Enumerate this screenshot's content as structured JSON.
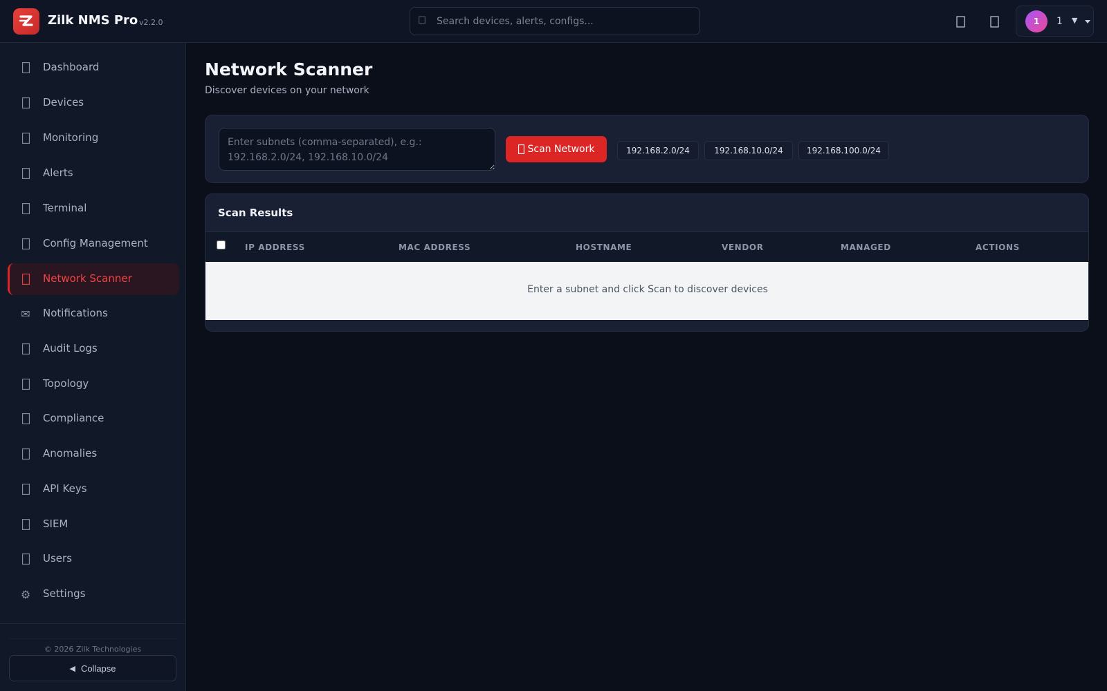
{
  "app": {
    "name": "Zilk NMS Pro",
    "version": "v2.2.0"
  },
  "search": {
    "placeholder": "Search devices, alerts, configs...",
    "value": ""
  },
  "user": {
    "avatar_initial": "1",
    "name": "1",
    "caret": "▼"
  },
  "sidebar": {
    "items": [
      {
        "label": "Dashboard",
        "icon": "dashboard-icon"
      },
      {
        "label": "Devices",
        "icon": "devices-icon"
      },
      {
        "label": "Monitoring",
        "icon": "monitoring-icon"
      },
      {
        "label": "Alerts",
        "icon": "alerts-icon"
      },
      {
        "label": "Terminal",
        "icon": "terminal-icon"
      },
      {
        "label": "Config Management",
        "icon": "config-icon"
      },
      {
        "label": "Network Scanner",
        "icon": "network-scanner-icon",
        "active": true
      },
      {
        "label": "Notifications",
        "icon": "envelope-icon"
      },
      {
        "label": "Audit Logs",
        "icon": "audit-logs-icon"
      },
      {
        "label": "Topology",
        "icon": "topology-icon"
      },
      {
        "label": "Compliance",
        "icon": "compliance-icon"
      },
      {
        "label": "Anomalies",
        "icon": "anomalies-icon"
      },
      {
        "label": "API Keys",
        "icon": "api-keys-icon"
      },
      {
        "label": "SIEM",
        "icon": "siem-icon"
      },
      {
        "label": "Users",
        "icon": "users-icon"
      },
      {
        "label": "Settings",
        "icon": "gear-icon"
      }
    ],
    "copyright": "© 2026 Zilk Technologies",
    "collapse_label": "Collapse",
    "collapse_icon": "◀"
  },
  "page": {
    "title": "Network Scanner",
    "subtitle": "Discover devices on your network"
  },
  "scanner": {
    "subnet_placeholder": "Enter subnets (comma-separated), e.g.: 192.168.2.0/24, 192.168.10.0/24",
    "subnet_value": "",
    "scan_button_label": "Scan Network",
    "presets": [
      "192.168.2.0/24",
      "192.168.10.0/24",
      "192.168.100.0/24"
    ]
  },
  "results": {
    "title": "Scan Results",
    "columns": [
      "IP ADDRESS",
      "MAC ADDRESS",
      "HOSTNAME",
      "VENDOR",
      "MANAGED",
      "ACTIONS"
    ],
    "empty_message": "Enter a subnet and click Scan to discover devices",
    "rows": []
  },
  "colors": {
    "accent": "#dc2626",
    "background": "#0b0f19",
    "sidebar": "#111827",
    "card": "#1a2033"
  }
}
